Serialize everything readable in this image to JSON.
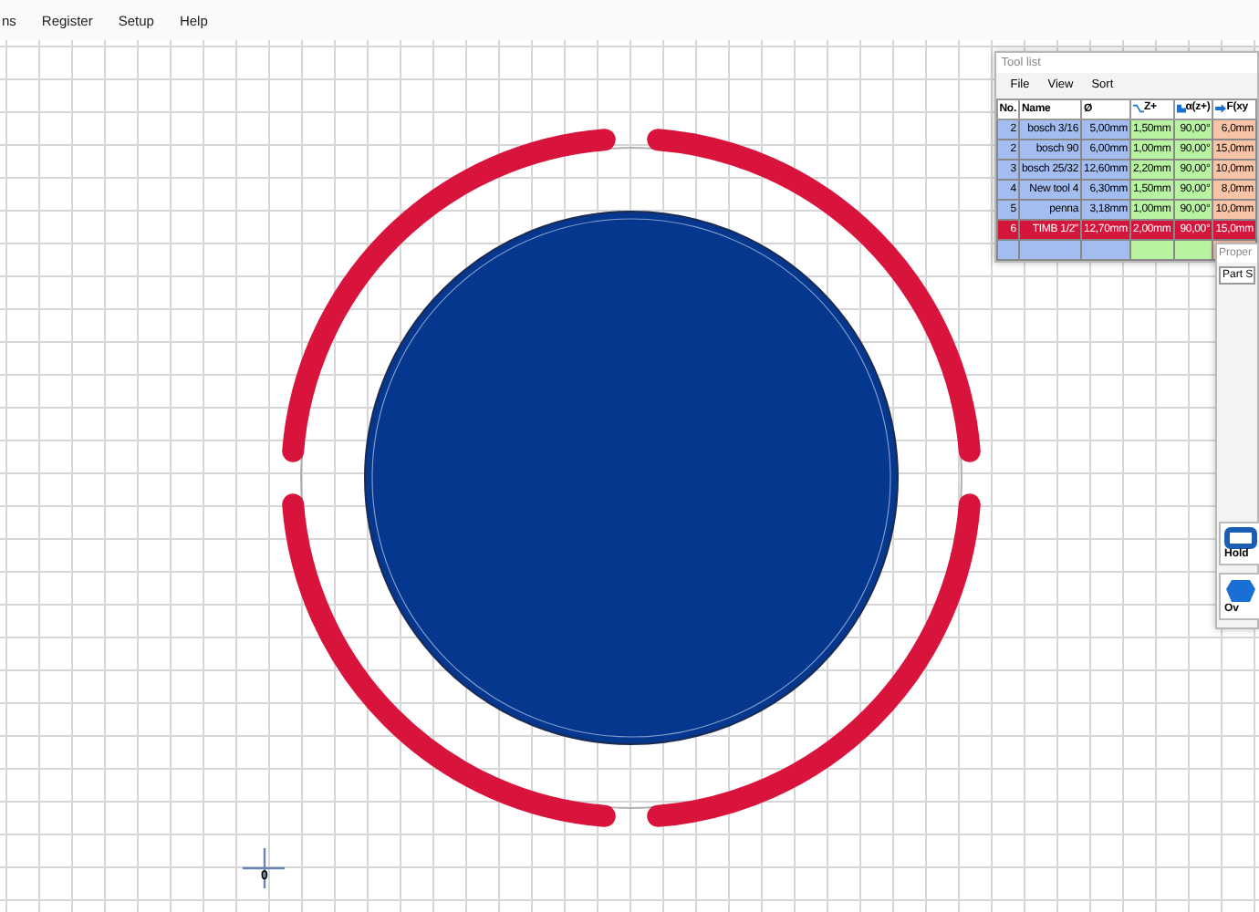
{
  "menu_bar": {
    "items": [
      "ns",
      "Register",
      "Setup",
      "Help"
    ]
  },
  "canvas": {
    "origin_label": "0"
  },
  "tool_list": {
    "title": "Tool list",
    "menu": [
      "File",
      "View",
      "Sort"
    ],
    "columns": [
      "No.",
      "Name",
      "Ø",
      "Z+",
      "α(z+)",
      "F(xy"
    ],
    "rows": [
      {
        "cells": [
          "2",
          "bosch 3/16",
          "5,00mm",
          "1,50mm",
          "90,00°",
          "6,0mm"
        ],
        "selected": false
      },
      {
        "cells": [
          "2",
          "bosch 90",
          "6,00mm",
          "1,00mm",
          "90,00°",
          "15,0mm"
        ],
        "selected": false
      },
      {
        "cells": [
          "3",
          "bosch 25/32",
          "12,60mm",
          "2,20mm",
          "90,00°",
          "10,0mm"
        ],
        "selected": false
      },
      {
        "cells": [
          "4",
          "New tool 4",
          "6,30mm",
          "1,50mm",
          "90,00°",
          "8,0mm"
        ],
        "selected": false
      },
      {
        "cells": [
          "5",
          "penna",
          "3,18mm",
          "1,00mm",
          "90,00°",
          "10,0mm"
        ],
        "selected": false
      },
      {
        "cells": [
          "6",
          "TIMB 1/2\"",
          "12,70mm",
          "2,00mm",
          "90,00°",
          "15,0mm"
        ],
        "selected": true
      }
    ]
  },
  "properties": {
    "title": "Proper",
    "field_value": "Part S",
    "tools": [
      {
        "label": "Hold"
      },
      {
        "label": "Ov"
      }
    ]
  }
}
